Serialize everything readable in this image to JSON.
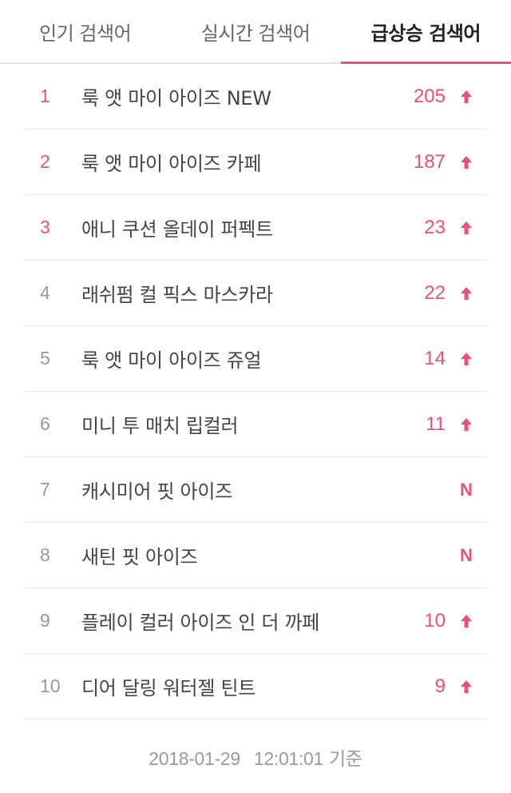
{
  "tabs": [
    {
      "label": "인기 검색어",
      "active": false
    },
    {
      "label": "실시간 검색어",
      "active": false
    },
    {
      "label": "급상승 검색어",
      "active": true
    }
  ],
  "colors": {
    "accent": "#f04f7b",
    "rank_default": "#999999",
    "divider": "#e6e6e6"
  },
  "rankings": [
    {
      "rank": "1",
      "term": "룩 앳 마이 아이즈 NEW",
      "change": "205",
      "status": "up"
    },
    {
      "rank": "2",
      "term": "룩 앳 마이 아이즈 카페",
      "change": "187",
      "status": "up"
    },
    {
      "rank": "3",
      "term": "애니 쿠션 올데이 퍼펙트",
      "change": "23",
      "status": "up"
    },
    {
      "rank": "4",
      "term": "래쉬펌 컬 픽스 마스카라",
      "change": "22",
      "status": "up"
    },
    {
      "rank": "5",
      "term": "룩 앳 마이 아이즈 쥬얼",
      "change": "14",
      "status": "up"
    },
    {
      "rank": "6",
      "term": "미니 투 매치 립컬러",
      "change": "11",
      "status": "up"
    },
    {
      "rank": "7",
      "term": "캐시미어 핏 아이즈",
      "change": "N",
      "status": "new"
    },
    {
      "rank": "8",
      "term": "새틴 핏 아이즈",
      "change": "N",
      "status": "new"
    },
    {
      "rank": "9",
      "term": "플레이 컬러 아이즈 인 더 까페",
      "change": "10",
      "status": "up"
    },
    {
      "rank": "10",
      "term": "디어 달링 워터젤 틴트",
      "change": "9",
      "status": "up"
    }
  ],
  "footer": {
    "date": "2018-01-29",
    "time": "12:01:01",
    "suffix": "기준"
  }
}
